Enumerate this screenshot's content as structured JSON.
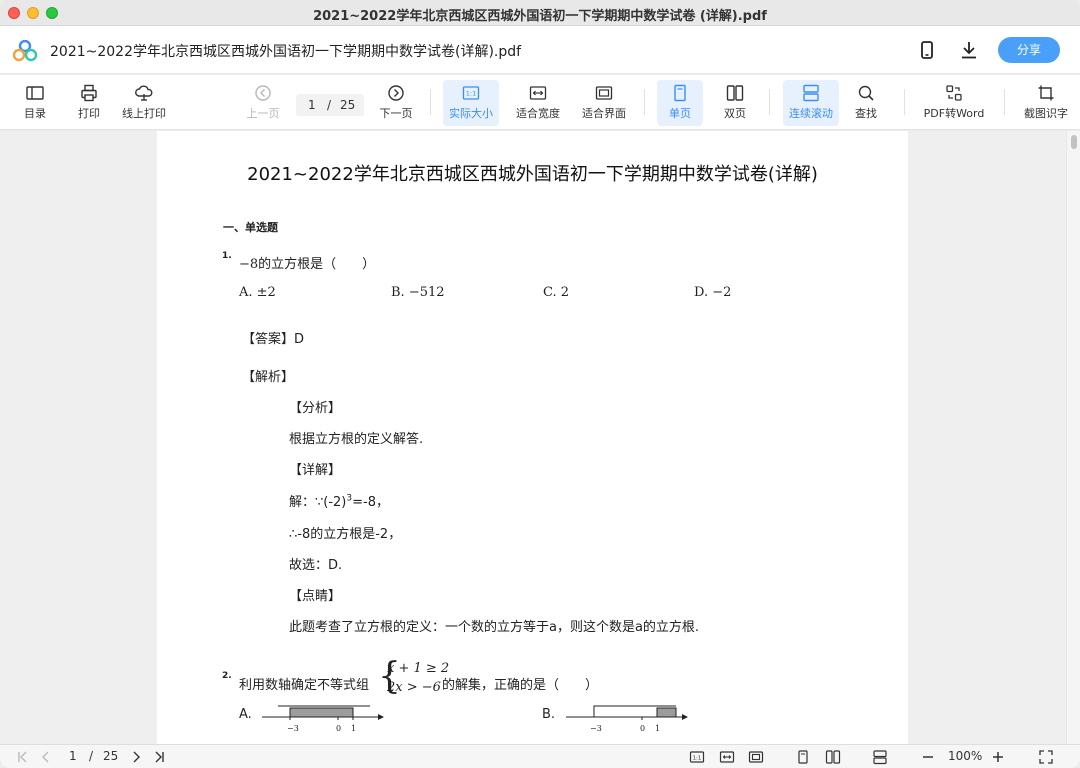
{
  "window": {
    "title": "2021~2022学年北京西城区西城外国语初一下学期期中数学试卷 (详解).pdf"
  },
  "header": {
    "doc_title": "2021~2022学年北京西城区西城外国语初一下学期期中数学试卷(详解).pdf",
    "share_label": "分享"
  },
  "toolbar": {
    "toc": "目录",
    "print": "打印",
    "online_print": "线上打印",
    "prev_page": "上一页",
    "next_page": "下一页",
    "page_current": "1",
    "page_sep": "/",
    "page_total": "25",
    "actual_size": "实际大小",
    "fit_width": "适合宽度",
    "fit_page": "适合界面",
    "single_page": "单页",
    "double_page": "双页",
    "continuous": "连续滚动",
    "find": "查找",
    "pdf_to_word": "PDF转Word",
    "ocr": "截图识字",
    "actual_size_icon_text": "1:1"
  },
  "document": {
    "title": "2021~2022学年北京西城区西城外国语初一下学期期中数学试卷(详解)",
    "section": "一、单选题",
    "q1": {
      "num": "1.",
      "stem_math": "−8",
      "stem_text": "的立方根是（　　）",
      "options": [
        "A. ±2",
        "B. −512",
        "C. 2",
        "D. −2"
      ],
      "answer": "【答案】D",
      "analysis": "【解析】",
      "fenxi": "【分析】",
      "fenxi_text": "根据立方根的定义解答.",
      "xiangjie": "【详解】",
      "step1_pre": "解：∵(-2)",
      "step1_sup": "3",
      "step1_post": "=-8，",
      "step2": "∴-8的立方根是-2，",
      "step3": "故选：D.",
      "dianjing": "【点睛】",
      "dianjing_text": "此题考查了立方根的定义：一个数的立方等于a，则这个数是a的立方根."
    },
    "q2": {
      "num": "2.",
      "stem_pre": "利用数轴确定不等式组",
      "ineq_line1": "x + 1 ≥ 2",
      "ineq_line2": "2x > −6",
      "stem_post": "的解集，正确的是（　　）",
      "optA": "A.",
      "optB": "B.",
      "axisA_labels": [
        "−3",
        "0",
        "1"
      ],
      "axisB_labels": [
        "−3",
        "0",
        "1"
      ]
    }
  },
  "statusbar": {
    "page_current": "1",
    "page_sep": "/",
    "page_total": "25",
    "zoom": "100%"
  },
  "colors": {
    "accent": "#4aa0f8",
    "active_bg": "#e7f1fd",
    "active_fg": "#3a8ef2"
  }
}
